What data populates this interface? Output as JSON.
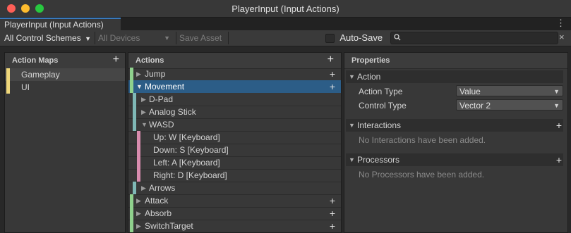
{
  "window": {
    "title": "PlayerInput (Input Actions)"
  },
  "tab": {
    "label": "PlayerInput (Input Actions)",
    "menu_glyph": "⋮"
  },
  "toolbar": {
    "control_schemes": "All Control Schemes",
    "devices": "All Devices",
    "save_asset": "Save Asset",
    "auto_save": "Auto-Save",
    "search_placeholder": "",
    "clear_glyph": "×"
  },
  "action_maps": {
    "header": "Action Maps",
    "items": [
      {
        "label": "Gameplay",
        "selected": true
      },
      {
        "label": "UI",
        "selected": false
      }
    ]
  },
  "actions": {
    "header": "Actions",
    "items": [
      {
        "label": "Jump"
      },
      {
        "label": "Movement"
      },
      {
        "label": "D-Pad"
      },
      {
        "label": "Analog Stick"
      },
      {
        "label": "WASD"
      },
      {
        "label": "Up: W [Keyboard]"
      },
      {
        "label": "Down: S [Keyboard]"
      },
      {
        "label": "Left: A [Keyboard]"
      },
      {
        "label": "Right: D [Keyboard]"
      },
      {
        "label": "Arrows"
      },
      {
        "label": "Attack"
      },
      {
        "label": "Absorb"
      },
      {
        "label": "SwitchTarget"
      }
    ]
  },
  "properties": {
    "header": "Properties",
    "action_section": "Action",
    "action_type_label": "Action Type",
    "action_type_value": "Value",
    "control_type_label": "Control Type",
    "control_type_value": "Vector 2",
    "interactions_section": "Interactions",
    "interactions_empty": "No Interactions have been added.",
    "processors_section": "Processors",
    "processors_empty": "No Processors have been added."
  },
  "colors": {
    "map_yellow": "#efd77a",
    "action_green": "#8fd18d",
    "binding_teal": "#7fb8b6",
    "part_pink": "#d88cae",
    "selection": "#2c5d87"
  }
}
